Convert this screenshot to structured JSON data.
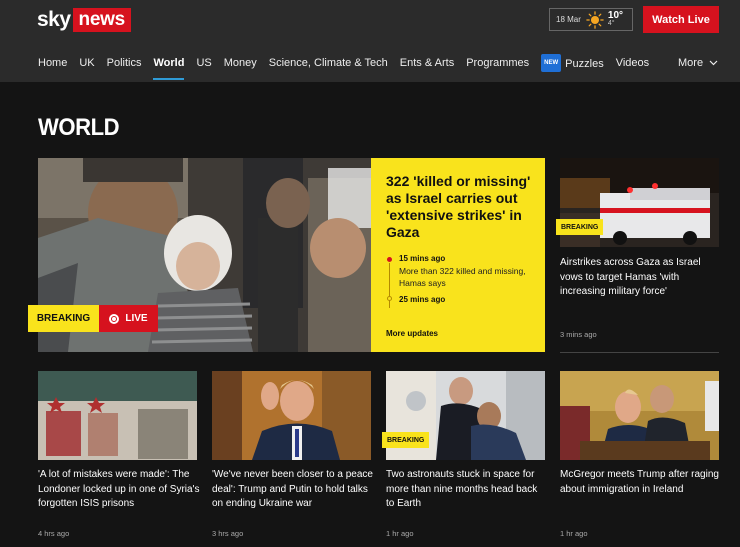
{
  "header": {
    "logo_sky": "sky",
    "logo_news": "news",
    "weather": {
      "date": "18 Mar",
      "high": "10°",
      "low": "4°",
      "icon": "sun-icon"
    },
    "watch_live": "Watch Live"
  },
  "nav": {
    "items": [
      {
        "label": "Home"
      },
      {
        "label": "UK"
      },
      {
        "label": "Politics"
      },
      {
        "label": "World",
        "active": true
      },
      {
        "label": "US"
      },
      {
        "label": "Money"
      },
      {
        "label": "Science, Climate & Tech"
      },
      {
        "label": "Ents & Arts"
      },
      {
        "label": "Programmes"
      },
      {
        "label": "Puzzles",
        "badge": "NEW"
      },
      {
        "label": "Videos"
      }
    ],
    "more": "More"
  },
  "page_title": "WORLD",
  "hero": {
    "breaking": "BREAKING",
    "live": "LIVE",
    "headline": "322 'killed or missing' as Israel carries out 'extensive strikes' in Gaza",
    "updates": [
      {
        "time": "15 mins ago",
        "text": "More than 322 killed and missing, Hamas says"
      },
      {
        "time": "25 mins ago",
        "text": ""
      }
    ],
    "more_updates": "More updates"
  },
  "side_story": {
    "tag": "BREAKING",
    "title": "Airstrikes across Gaza as Israel vows to target Hamas 'with increasing military force'",
    "time": "3 mins ago"
  },
  "cards": [
    {
      "title": "'A lot of mistakes were made': The Londoner locked up in one of Syria's forgotten ISIS prisons",
      "time": "4 hrs ago",
      "tag": ""
    },
    {
      "title": "'We've never been closer to a peace deal': Trump and Putin to hold talks on ending Ukraine war",
      "time": "3 hrs ago",
      "tag": ""
    },
    {
      "title": "Two astronauts stuck in space for more than nine months head back to Earth",
      "time": "1 hr ago",
      "tag": "BREAKING"
    },
    {
      "title": "McGregor meets Trump after raging about immigration in Ireland",
      "time": "1 hr ago",
      "tag": ""
    }
  ],
  "colors": {
    "brand_red": "#d6121e",
    "breaking_yellow": "#f9e31c",
    "active_blue": "#2f9bd6",
    "header_bg": "#2b2b2b"
  }
}
